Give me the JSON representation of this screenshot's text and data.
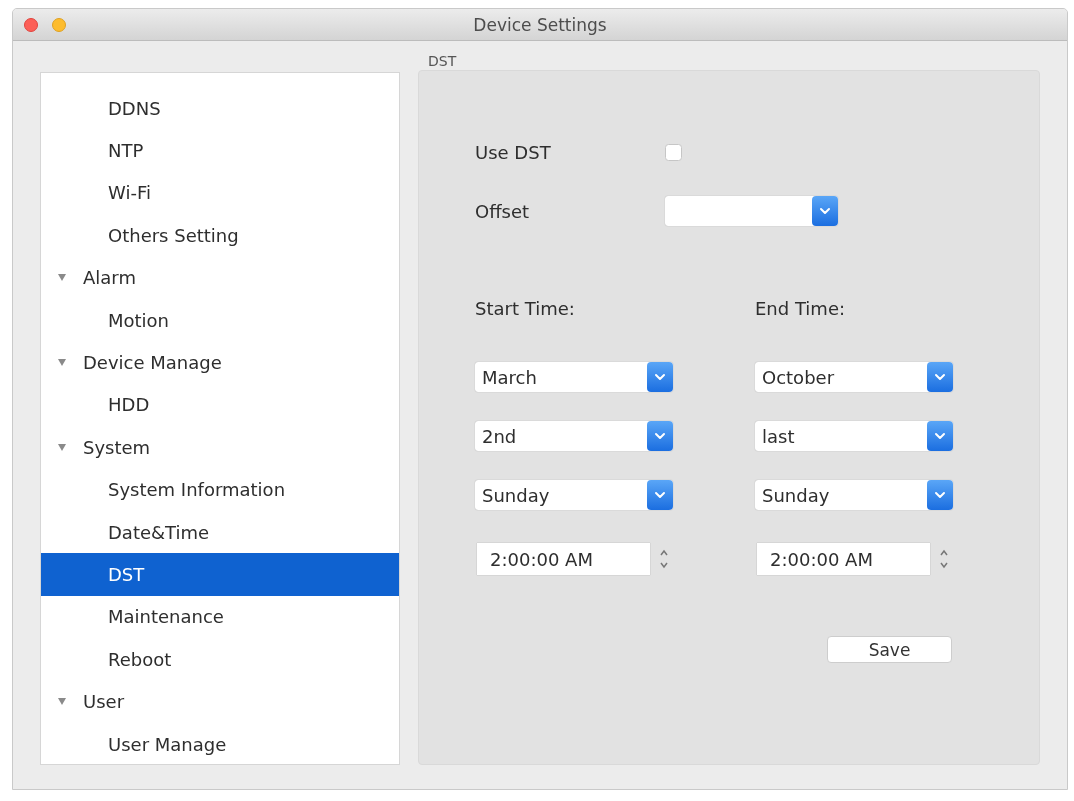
{
  "window": {
    "title": "Device Settings"
  },
  "sidebar": {
    "items": [
      {
        "children": [
          {
            "label": "DDNS",
            "selected": false
          },
          {
            "label": "NTP",
            "selected": false
          },
          {
            "label": "Wi-Fi",
            "selected": false
          },
          {
            "label": "Others Setting",
            "selected": false
          }
        ]
      },
      {
        "label": "Alarm",
        "expanded": true,
        "selected": false,
        "children": [
          {
            "label": "Motion",
            "selected": false
          }
        ]
      },
      {
        "label": "Device Manage",
        "expanded": true,
        "selected": false,
        "children": [
          {
            "label": "HDD",
            "selected": false
          }
        ]
      },
      {
        "label": "System",
        "expanded": true,
        "selected": false,
        "children": [
          {
            "label": "System Information",
            "selected": false
          },
          {
            "label": "Date&Time",
            "selected": false
          },
          {
            "label": "DST",
            "selected": true
          },
          {
            "label": "Maintenance",
            "selected": false
          },
          {
            "label": "Reboot",
            "selected": false
          }
        ]
      },
      {
        "label": "User",
        "expanded": true,
        "selected": false,
        "children": [
          {
            "label": "User Manage",
            "selected": false
          }
        ]
      }
    ]
  },
  "panel": {
    "title": "DST",
    "use_dst": {
      "label": "Use DST",
      "checked": false
    },
    "offset": {
      "label": "Offset"
    },
    "start": {
      "label": "Start Time:",
      "month": "March",
      "week": "2nd",
      "weekday": "Sunday",
      "time": "2:00:00 AM"
    },
    "end": {
      "label": "End Time:",
      "month": "October",
      "week": "last",
      "weekday": "Sunday",
      "time": "2:00:00 AM"
    },
    "save_button": "Save"
  }
}
